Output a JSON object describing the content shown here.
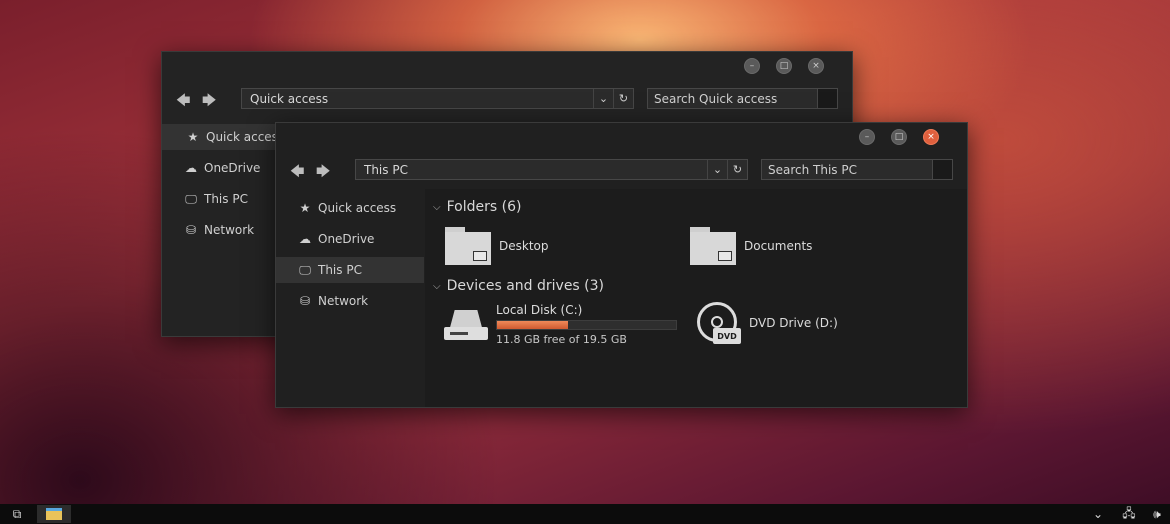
{
  "back_window": {
    "address": "Quick access",
    "search_placeholder": "Search Quick access",
    "sidebar": [
      {
        "label": "Quick access",
        "icon": "star-icon",
        "active": true
      },
      {
        "label": "OneDrive",
        "icon": "cloud-icon",
        "active": false
      },
      {
        "label": "This PC",
        "icon": "monitor-icon",
        "active": false
      },
      {
        "label": "Network",
        "icon": "network-icon",
        "active": false
      }
    ]
  },
  "front_window": {
    "address": "This PC",
    "search_placeholder": "Search This PC",
    "sidebar": [
      {
        "label": "Quick access",
        "icon": "star-icon",
        "active": false
      },
      {
        "label": "OneDrive",
        "icon": "cloud-icon",
        "active": false
      },
      {
        "label": "This PC",
        "icon": "monitor-icon",
        "active": true
      },
      {
        "label": "Network",
        "icon": "network-icon",
        "active": false
      }
    ],
    "folders_heading": "Folders (6)",
    "folders": [
      {
        "label": "Desktop"
      },
      {
        "label": "Documents"
      }
    ],
    "devices_heading": "Devices and drives (3)",
    "drives": [
      {
        "label": "Local Disk (C:)",
        "free_text": "11.8 GB free of 19.5 GB",
        "used_fraction": 0.395
      },
      {
        "label": "DVD Drive (D:)",
        "badge": "DVD"
      }
    ]
  },
  "colors": {
    "accent": "#e0603e",
    "window_bg": "#202020",
    "content_bg": "#1c1c1c"
  }
}
